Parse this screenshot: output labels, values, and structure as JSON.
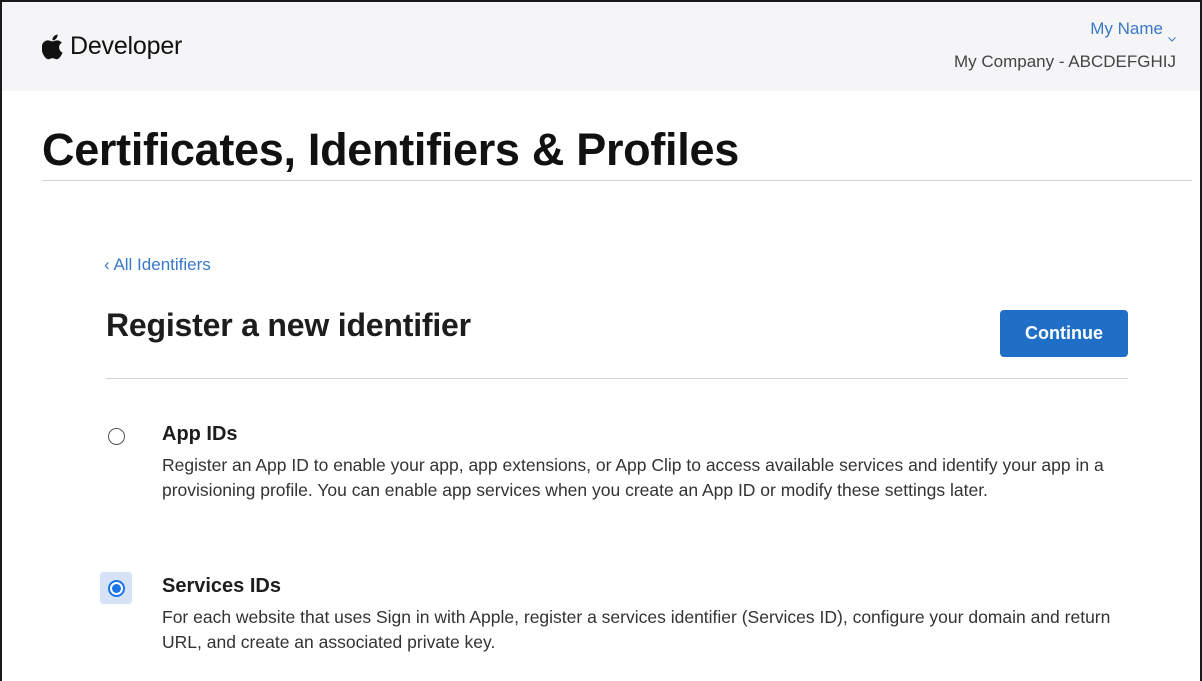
{
  "header": {
    "brand_label": "Developer",
    "account_name": "My Name",
    "team_label": "My Company - ABCDEFGHIJ"
  },
  "page": {
    "title": "Certificates, Identifiers & Profiles"
  },
  "nav": {
    "back_label": "‹ All Identifiers"
  },
  "section": {
    "title": "Register a new identifier",
    "continue_label": "Continue"
  },
  "options": [
    {
      "title": "App IDs",
      "description": "Register an App ID to enable your app, app extensions, or App Clip to access available services and identify your app in a provisioning profile. You can enable app services when you create an App ID or modify these settings later.",
      "selected": false
    },
    {
      "title": "Services IDs",
      "description": "For each website that uses Sign in with Apple, register a services identifier (Services ID), configure your domain and return URL, and create an associated private key.",
      "selected": true
    }
  ],
  "colors": {
    "accent": "#1f6fc7",
    "link": "#3a78c8",
    "header_bg": "#f5f5f7"
  },
  "icons": {
    "brand": "apple-logo-icon",
    "account_menu": "chevron-down-icon"
  }
}
